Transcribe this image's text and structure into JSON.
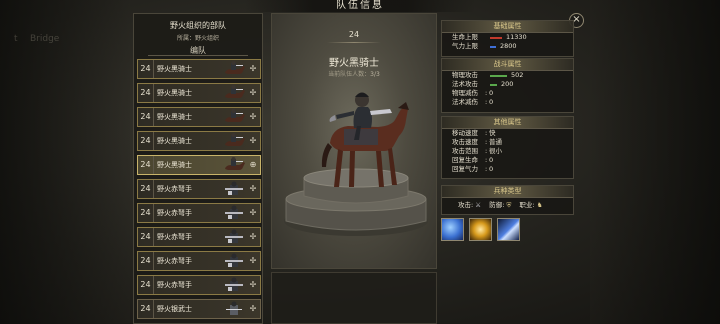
{
  "window_title": "队伍信息",
  "background": {
    "left_fragment": "Bridge",
    "left_fragment2": "t"
  },
  "squad": {
    "name": "野火组织的部队",
    "affiliation": "所属：野火组织",
    "section_label": "编队",
    "units": [
      {
        "level": "24",
        "name": "野火黑骑士",
        "selected": false,
        "type": "knight"
      },
      {
        "level": "24",
        "name": "野火黑骑士",
        "selected": false,
        "type": "knight"
      },
      {
        "level": "24",
        "name": "野火黑骑士",
        "selected": false,
        "type": "knight"
      },
      {
        "level": "24",
        "name": "野火黑骑士",
        "selected": false,
        "type": "knight"
      },
      {
        "level": "24",
        "name": "野火黑骑士",
        "selected": true,
        "type": "knight"
      },
      {
        "level": "24",
        "name": "野火赤弩手",
        "selected": false,
        "type": "crossbow"
      },
      {
        "level": "24",
        "name": "野火赤弩手",
        "selected": false,
        "type": "crossbow"
      },
      {
        "level": "24",
        "name": "野火赤弩手",
        "selected": false,
        "type": "crossbow"
      },
      {
        "level": "24",
        "name": "野火赤弩手",
        "selected": false,
        "type": "crossbow"
      },
      {
        "level": "24",
        "name": "野火赤弩手",
        "selected": false,
        "type": "crossbow"
      },
      {
        "level": "24",
        "name": "野火银武士",
        "selected": false,
        "type": "samurai"
      }
    ]
  },
  "unit_detail": {
    "level": "24",
    "name": "野火黑骑士",
    "count_label": "当前队伍人数：",
    "count_value": "3/3"
  },
  "stats": {
    "basic": {
      "header": "基础属性",
      "rows": [
        {
          "label": "生命上限",
          "value": "11330",
          "bar_color": "#c23a2c",
          "bar_fraction": 0.35
        },
        {
          "label": "气力上限",
          "value": "2800",
          "bar_color": "#3f6fd6",
          "bar_fraction": 0.18
        }
      ]
    },
    "combat": {
      "header": "战斗属性",
      "rows": [
        {
          "label": "物理攻击",
          "value": "502",
          "bar_color": "#5aa84c",
          "bar_fraction": 0.5
        },
        {
          "label": "法术攻击",
          "value": "200",
          "bar_color": "#5aa84c",
          "bar_fraction": 0.2
        },
        {
          "label": "物理减伤",
          "value": "0"
        },
        {
          "label": "法术减伤",
          "value": "0"
        }
      ]
    },
    "other": {
      "header": "其他属性",
      "rows": [
        {
          "label": "移动速度",
          "value": "快"
        },
        {
          "label": "攻击速度",
          "value": "普通"
        },
        {
          "label": "攻击范围",
          "value": "很小"
        },
        {
          "label": "回复生命",
          "value": "0"
        },
        {
          "label": "回复气力",
          "value": "0"
        }
      ]
    },
    "type": {
      "header": "兵种类型",
      "attack_label": "攻击:",
      "defense_label": "防御:",
      "class_label": "职业:"
    }
  },
  "skills": [
    {
      "name": "lightning-slash-skill",
      "color": "#3a6fd0"
    },
    {
      "name": "fire-burst-skill",
      "color": "#d79a1c"
    },
    {
      "name": "blue-sword-skill",
      "color": "#4f7fe0"
    }
  ],
  "close_label": "×",
  "colors": {
    "accent_gold": "#c9b46a",
    "header_gold": "#d8c68a"
  }
}
